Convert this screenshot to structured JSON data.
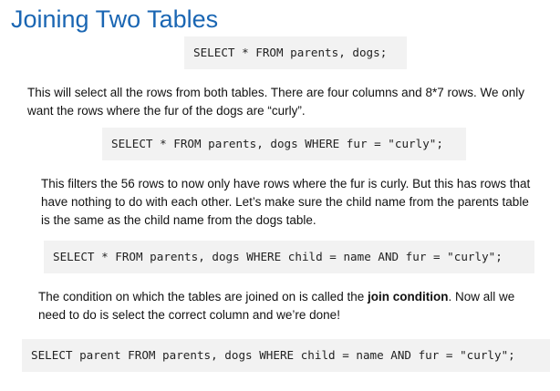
{
  "page": {
    "title": "Joining Two Tables"
  },
  "blocks": {
    "code1": "SELECT * FROM parents, dogs;",
    "para1": "This will select all the rows from both tables. There are four columns and 8*7 rows. We only want the rows where the fur of the dogs are “curly”.",
    "code2": "SELECT * FROM parents, dogs WHERE fur = \"curly\";",
    "para2": "This filters the 56 rows to now only have rows where the fur is curly. But this has rows that have nothing to do with each other. Let’s make sure the child name from the parents table is the same as the child name from the dogs table.",
    "code3": "SELECT * FROM parents, dogs WHERE child = name AND fur = \"curly\";",
    "para3_before": "The condition on which the tables are joined on is called the ",
    "para3_bold": "join condition",
    "para3_after": ". Now all we need to do is select the correct column and we’re done!",
    "code4": "SELECT parent FROM parents, dogs WHERE child = name AND fur = \"curly\";"
  },
  "colors": {
    "title": "#1a66b3",
    "code_background": "#f2f2f2",
    "text": "#111111"
  }
}
